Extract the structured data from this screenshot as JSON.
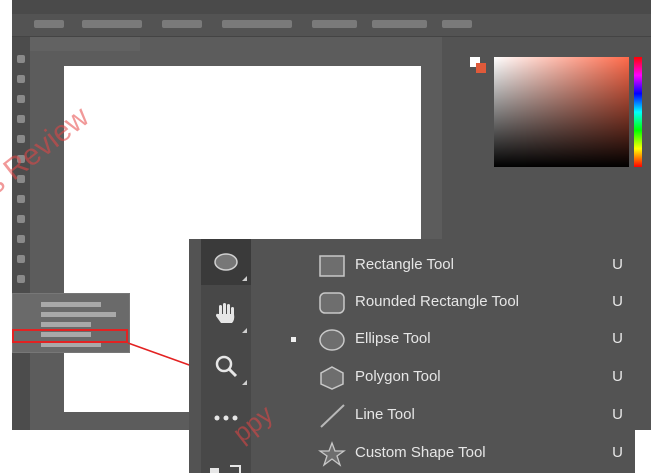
{
  "watermark": {
    "text_top": "s Review",
    "text_bottom": "ppy"
  },
  "zoom_menu": {
    "items": [
      {
        "label": "Rectangle Tool",
        "shortcut": "U",
        "icon": "rectangle-icon",
        "selected": false
      },
      {
        "label": "Rounded Rectangle Tool",
        "shortcut": "U",
        "icon": "rounded-rectangle-icon",
        "selected": false
      },
      {
        "label": "Ellipse Tool",
        "shortcut": "U",
        "icon": "ellipse-icon",
        "selected": true
      },
      {
        "label": "Polygon Tool",
        "shortcut": "U",
        "icon": "polygon-icon",
        "selected": false
      },
      {
        "label": "Line Tool",
        "shortcut": "U",
        "icon": "line-icon",
        "selected": false
      },
      {
        "label": "Custom Shape Tool",
        "shortcut": "U",
        "icon": "custom-shape-icon",
        "selected": false
      }
    ]
  },
  "zoom_tools": [
    "ellipse-icon",
    "hand-icon",
    "zoom-icon",
    "more-icon",
    "swap-colors-icon"
  ],
  "colors": {
    "highlight": "#e32222",
    "panel": "#535353",
    "toolstrip": "#484848",
    "picker_hue": "#ff6a4a"
  }
}
